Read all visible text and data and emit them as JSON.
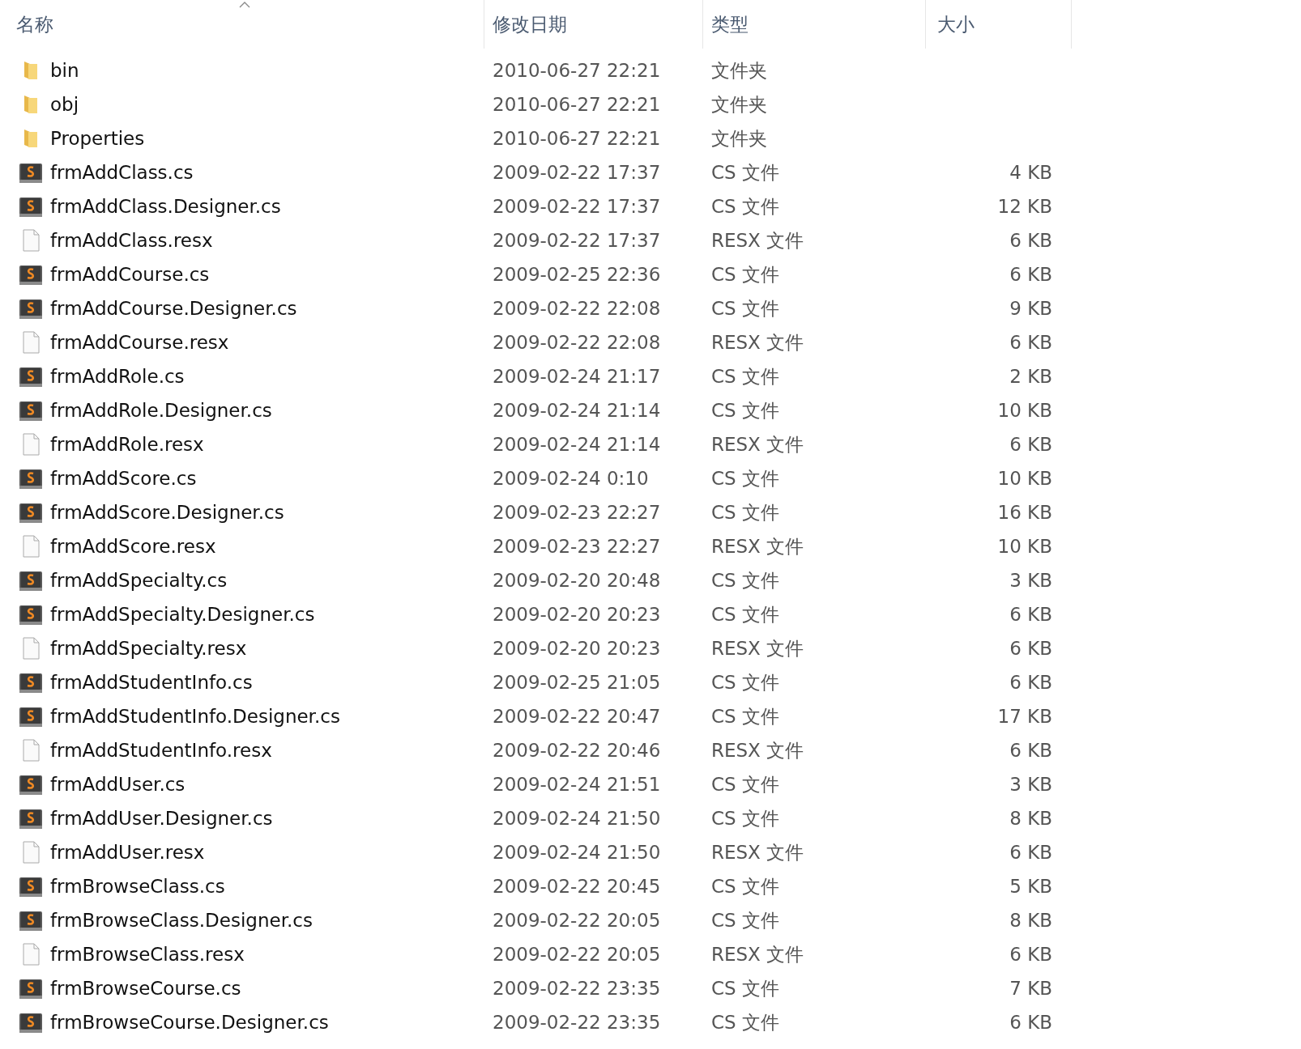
{
  "columns": [
    {
      "label": "名称",
      "sorted": true
    },
    {
      "label": "修改日期",
      "sorted": false
    },
    {
      "label": "类型",
      "sorted": false
    },
    {
      "label": "大小",
      "sorted": false
    }
  ],
  "rows": [
    {
      "kind": "folder",
      "name": "bin",
      "modified": "2010-06-27 22:21",
      "type": "文件夹"
    },
    {
      "kind": "folder",
      "name": "obj",
      "modified": "2010-06-27 22:21",
      "type": "文件夹"
    },
    {
      "kind": "folder",
      "name": "Properties",
      "modified": "2010-06-27 22:21",
      "type": "文件夹"
    },
    {
      "kind": "cs",
      "name": "frmAddClass.cs",
      "modified": "2009-02-22 17:37",
      "type": "CS 文件",
      "size": "4 KB"
    },
    {
      "kind": "cs",
      "name": "frmAddClass.Designer.cs",
      "modified": "2009-02-22 17:37",
      "type": "CS 文件",
      "size": "12 KB"
    },
    {
      "kind": "resx",
      "name": "frmAddClass.resx",
      "modified": "2009-02-22 17:37",
      "type": "RESX 文件",
      "size": "6 KB"
    },
    {
      "kind": "cs",
      "name": "frmAddCourse.cs",
      "modified": "2009-02-25 22:36",
      "type": "CS 文件",
      "size": "6 KB"
    },
    {
      "kind": "cs",
      "name": "frmAddCourse.Designer.cs",
      "modified": "2009-02-22 22:08",
      "type": "CS 文件",
      "size": "9 KB"
    },
    {
      "kind": "resx",
      "name": "frmAddCourse.resx",
      "modified": "2009-02-22 22:08",
      "type": "RESX 文件",
      "size": "6 KB"
    },
    {
      "kind": "cs",
      "name": "frmAddRole.cs",
      "modified": "2009-02-24 21:17",
      "type": "CS 文件",
      "size": "2 KB"
    },
    {
      "kind": "cs",
      "name": "frmAddRole.Designer.cs",
      "modified": "2009-02-24 21:14",
      "type": "CS 文件",
      "size": "10 KB"
    },
    {
      "kind": "resx",
      "name": "frmAddRole.resx",
      "modified": "2009-02-24 21:14",
      "type": "RESX 文件",
      "size": "6 KB"
    },
    {
      "kind": "cs",
      "name": "frmAddScore.cs",
      "modified": "2009-02-24 0:10",
      "type": "CS 文件",
      "size": "10 KB"
    },
    {
      "kind": "cs",
      "name": "frmAddScore.Designer.cs",
      "modified": "2009-02-23 22:27",
      "type": "CS 文件",
      "size": "16 KB"
    },
    {
      "kind": "resx",
      "name": "frmAddScore.resx",
      "modified": "2009-02-23 22:27",
      "type": "RESX 文件",
      "size": "10 KB"
    },
    {
      "kind": "cs",
      "name": "frmAddSpecialty.cs",
      "modified": "2009-02-20 20:48",
      "type": "CS 文件",
      "size": "3 KB"
    },
    {
      "kind": "cs",
      "name": "frmAddSpecialty.Designer.cs",
      "modified": "2009-02-20 20:23",
      "type": "CS 文件",
      "size": "6 KB"
    },
    {
      "kind": "resx",
      "name": "frmAddSpecialty.resx",
      "modified": "2009-02-20 20:23",
      "type": "RESX 文件",
      "size": "6 KB"
    },
    {
      "kind": "cs",
      "name": "frmAddStudentInfo.cs",
      "modified": "2009-02-25 21:05",
      "type": "CS 文件",
      "size": "6 KB"
    },
    {
      "kind": "cs",
      "name": "frmAddStudentInfo.Designer.cs",
      "modified": "2009-02-22 20:47",
      "type": "CS 文件",
      "size": "17 KB"
    },
    {
      "kind": "resx",
      "name": "frmAddStudentInfo.resx",
      "modified": "2009-02-22 20:46",
      "type": "RESX 文件",
      "size": "6 KB"
    },
    {
      "kind": "cs",
      "name": "frmAddUser.cs",
      "modified": "2009-02-24 21:51",
      "type": "CS 文件",
      "size": "3 KB"
    },
    {
      "kind": "cs",
      "name": "frmAddUser.Designer.cs",
      "modified": "2009-02-24 21:50",
      "type": "CS 文件",
      "size": "8 KB"
    },
    {
      "kind": "resx",
      "name": "frmAddUser.resx",
      "modified": "2009-02-24 21:50",
      "type": "RESX 文件",
      "size": "6 KB"
    },
    {
      "kind": "cs",
      "name": "frmBrowseClass.cs",
      "modified": "2009-02-22 20:45",
      "type": "CS 文件",
      "size": "5 KB"
    },
    {
      "kind": "cs",
      "name": "frmBrowseClass.Designer.cs",
      "modified": "2009-02-22 20:05",
      "type": "CS 文件",
      "size": "8 KB"
    },
    {
      "kind": "resx",
      "name": "frmBrowseClass.resx",
      "modified": "2009-02-22 20:05",
      "type": "RESX 文件",
      "size": "6 KB"
    },
    {
      "kind": "cs",
      "name": "frmBrowseCourse.cs",
      "modified": "2009-02-22 23:35",
      "type": "CS 文件",
      "size": "7 KB"
    },
    {
      "kind": "cs",
      "name": "frmBrowseCourse.Designer.cs",
      "modified": "2009-02-22 23:35",
      "type": "CS 文件",
      "size": "6 KB"
    }
  ]
}
